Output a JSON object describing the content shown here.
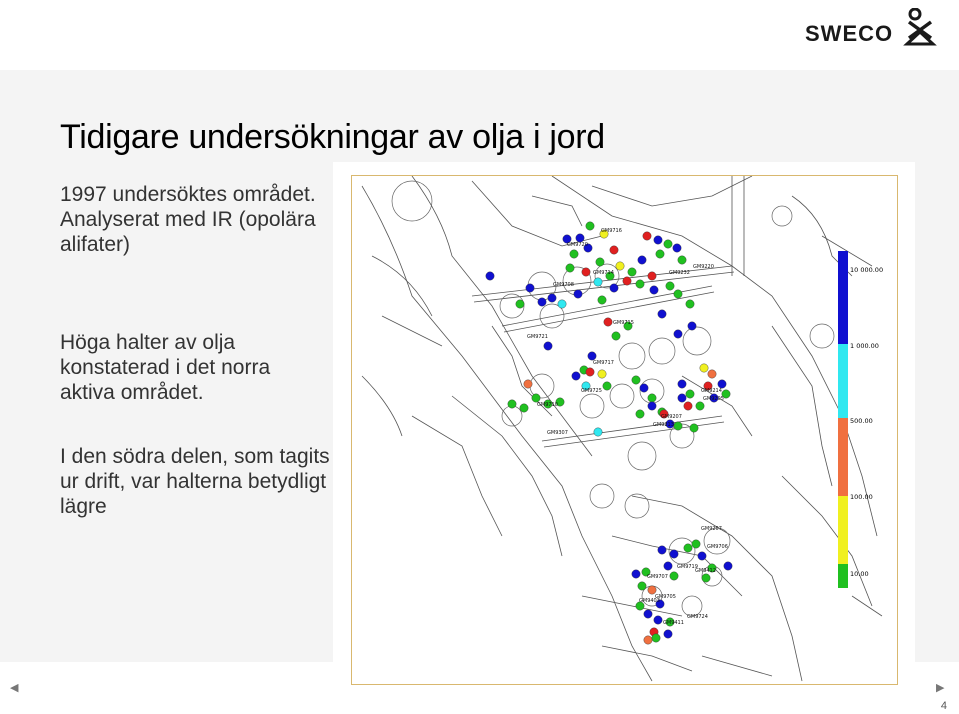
{
  "logo": {
    "text": "SWECO",
    "mark_icon": "sweco-person-icon"
  },
  "title": "Tidigare undersökningar av olja i jord",
  "paragraphs": [
    "1997 undersöktes området. Analyserat med IR (opolära alifater)",
    "Höga halter av olja konstaterad i det norra aktiva området.",
    "I den södra delen, som tagits ur drift, var halterna betydligt lägre"
  ],
  "legend": {
    "ticks": [
      "10 000.00",
      "1 000.00",
      "500.00",
      "100.00",
      "10.00"
    ],
    "colors": [
      "#1010d0",
      "#30e8f0",
      "#f07040",
      "#f0f020",
      "#20c020"
    ]
  },
  "samples": [
    {
      "color": "#f0f020"
    },
    {
      "color": "#20c020"
    },
    {
      "color": "#1010d0"
    },
    {
      "color": "#e02020"
    }
  ],
  "map_labels": [
    "GM9716",
    "GM9720",
    "GM9714",
    "GM9708",
    "GM9721",
    "GM9717",
    "GM9725",
    "GM9710",
    "GM9307",
    "GM9715",
    "GM9220",
    "GM9207",
    "GM9213",
    "GM9214",
    "GM9205",
    "GM9232",
    "GM9207",
    "GM9706",
    "GM9719",
    "GM9707",
    "GM9412",
    "GM9705",
    "GM9403",
    "GM9724",
    "GM9411"
  ],
  "nav": {
    "prev": "◀",
    "next": "▶"
  },
  "page_number": "4"
}
